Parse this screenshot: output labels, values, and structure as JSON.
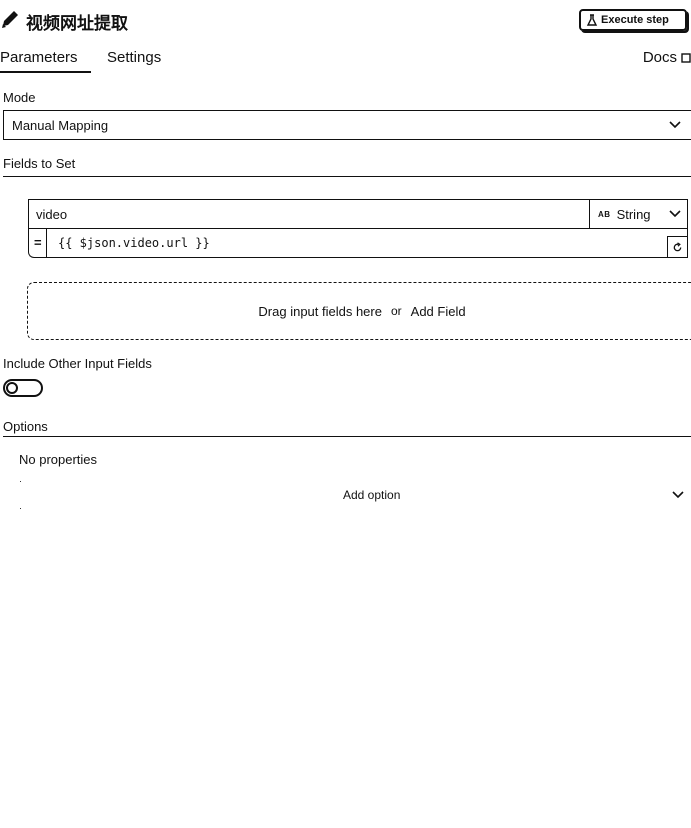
{
  "header": {
    "title": "视频网址提取",
    "execute_label": "Execute step"
  },
  "tabs": {
    "parameters": "Parameters",
    "settings": "Settings",
    "docs": "Docs"
  },
  "mode": {
    "label": "Mode",
    "value": "Manual Mapping"
  },
  "fields_to_set": {
    "label": "Fields to Set",
    "field": {
      "name": "video",
      "type_badge": "AB",
      "type": "String",
      "equals": "=",
      "value": "{{ $json.video.url }}"
    },
    "dropzone": {
      "drag_text": "Drag input fields here",
      "or_text": "or",
      "add_field": "Add Field"
    }
  },
  "include_other": {
    "label": "Include Other Input Fields",
    "enabled": false
  },
  "options": {
    "label": "Options",
    "empty_text": "No properties",
    "add_option": "Add option"
  },
  "icons": [
    "pencil-icon",
    "flask-icon",
    "external-link-icon",
    "chevron-down-icon",
    "reset-icon"
  ]
}
